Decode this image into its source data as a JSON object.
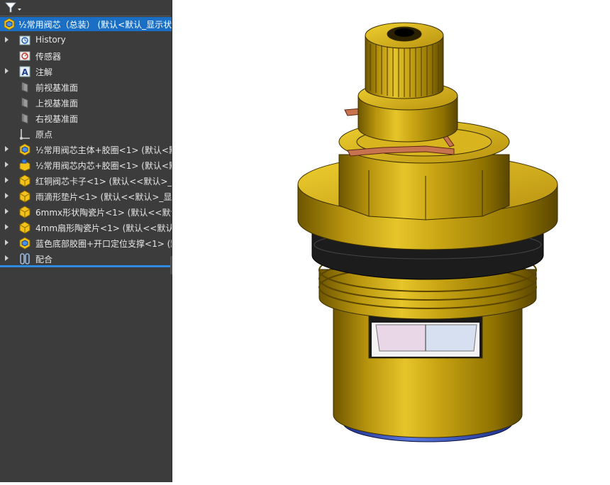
{
  "tree": {
    "root": {
      "label": "½常用阀芯（总装） (默认<默认_显示状",
      "icon": "assembly-icon"
    },
    "items": [
      {
        "label": "History",
        "icon": "history-icon",
        "expandable": true
      },
      {
        "label": "传感器",
        "icon": "sensor-icon",
        "expandable": false
      },
      {
        "label": "注解",
        "icon": "annotation-icon",
        "expandable": true
      },
      {
        "label": "前视基准面",
        "icon": "plane-icon",
        "expandable": false
      },
      {
        "label": "上视基准面",
        "icon": "plane-icon",
        "expandable": false
      },
      {
        "label": "右视基准面",
        "icon": "plane-icon",
        "expandable": false
      },
      {
        "label": "原点",
        "icon": "origin-icon",
        "expandable": false
      },
      {
        "label": "½常用阀芯主体+胶圈<1> (默认<默",
        "icon": "subassembly-icon",
        "expandable": true
      },
      {
        "label": "½常用阀芯内芯+胶圈<1> (默认<默",
        "icon": "subassembly-fixed-icon",
        "expandable": true
      },
      {
        "label": "红铜阀芯卡子<1> (默认<<默认>_显",
        "icon": "part-icon",
        "expandable": true
      },
      {
        "label": "雨滴形垫片<1> (默认<<默认>_显示",
        "icon": "part-icon",
        "expandable": true
      },
      {
        "label": "6mmx形状陶瓷片<1> (默认<<默认",
        "icon": "part-icon",
        "expandable": true
      },
      {
        "label": "4mm扇形陶瓷片<1> (默认<<默认",
        "icon": "part-icon",
        "expandable": true
      },
      {
        "label": "蓝色底部胶圈+开口定位支撑<1> (默",
        "icon": "subassembly-icon",
        "expandable": true
      },
      {
        "label": "配合",
        "icon": "mates-icon",
        "expandable": true
      }
    ]
  },
  "viewport": {
    "model": "faucet-valve-cartridge",
    "colors": {
      "brass": "#c9a514",
      "seal": "#1c1c1c",
      "blue_ring": "#3b57c8",
      "copper_clip": "#c8734f"
    }
  }
}
